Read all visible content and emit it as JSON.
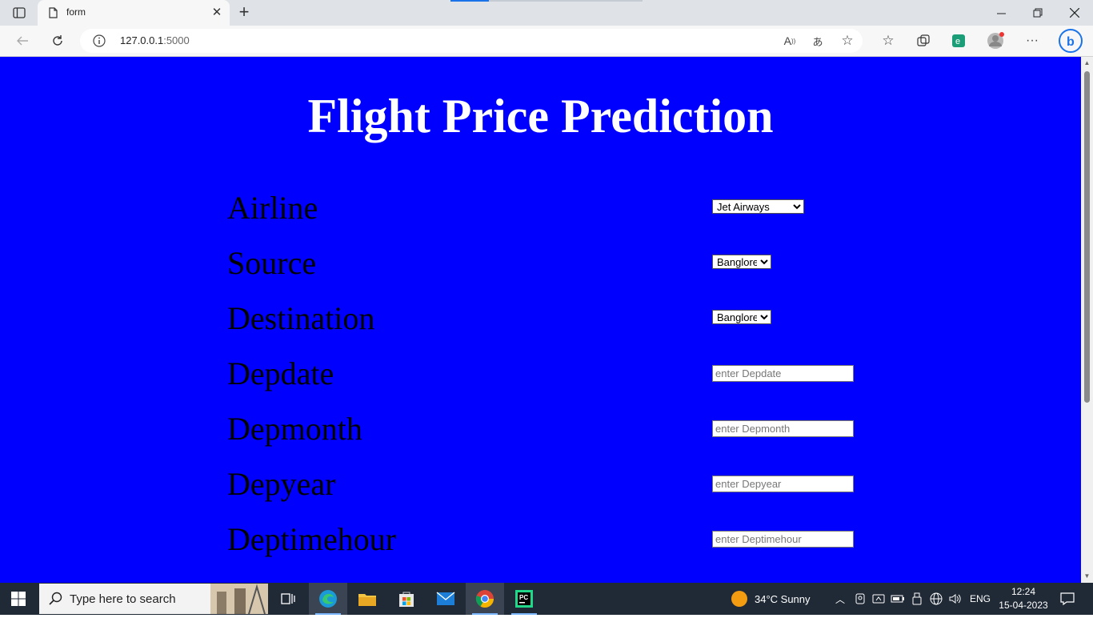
{
  "browser": {
    "tab_title": "form",
    "url_host": "127.0.0.1",
    "url_port": ":5000"
  },
  "page": {
    "heading": "Flight Price Prediction",
    "fields": [
      {
        "label": "Airline",
        "type": "select",
        "value": "Jet Airways"
      },
      {
        "label": "Source",
        "type": "select",
        "value": "Banglore"
      },
      {
        "label": "Destination",
        "type": "select",
        "value": "Banglore"
      },
      {
        "label": "Depdate",
        "type": "input",
        "placeholder": "enter Depdate"
      },
      {
        "label": "Depmonth",
        "type": "input",
        "placeholder": "enter Depmonth"
      },
      {
        "label": "Depyear",
        "type": "input",
        "placeholder": "enter Depyear"
      },
      {
        "label": "Deptimehour",
        "type": "input",
        "placeholder": "enter Deptimehour"
      }
    ]
  },
  "taskbar": {
    "search_placeholder": "Type here to search",
    "weather": "34°C  Sunny",
    "language": "ENG",
    "time": "12:24",
    "date": "15-04-2023"
  },
  "colors": {
    "page_background": "#0000ff",
    "heading": "#ffffff",
    "labels": "#000000",
    "taskbar": "#202a36"
  }
}
